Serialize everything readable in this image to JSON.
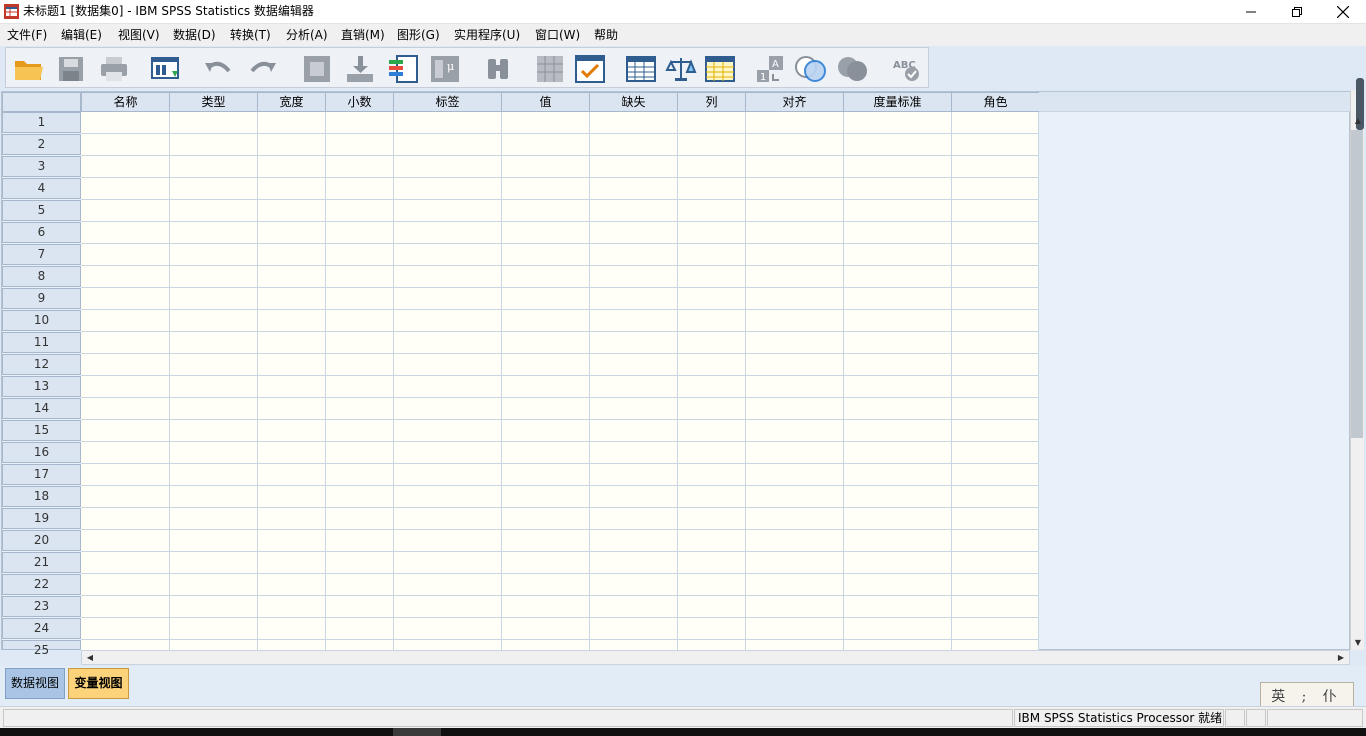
{
  "window": {
    "title": "未标题1 [数据集0] - IBM SPSS Statistics 数据编辑器"
  },
  "menu": [
    "文件(F)",
    "编辑(E)",
    "视图(V)",
    "数据(D)",
    "转换(T)",
    "分析(A)",
    "直销(M)",
    "图形(G)",
    "实用程序(U)",
    "窗口(W)",
    "帮助"
  ],
  "toolbar": [
    {
      "icon": "open-folder-icon"
    },
    {
      "icon": "save-icon"
    },
    {
      "icon": "print-icon"
    },
    {
      "icon": "recall-dialog-icon"
    },
    {
      "icon": "undo-icon"
    },
    {
      "icon": "redo-icon"
    },
    {
      "icon": "goto-case-icon"
    },
    {
      "icon": "goto-variable-icon"
    },
    {
      "icon": "variables-icon"
    },
    {
      "icon": "run-descriptives-icon"
    },
    {
      "icon": "find-icon"
    },
    {
      "icon": "insert-cases-icon"
    },
    {
      "icon": "insert-variable-icon"
    },
    {
      "icon": "split-file-icon"
    },
    {
      "icon": "weight-cases-icon"
    },
    {
      "icon": "select-cases-icon"
    },
    {
      "icon": "value-labels-icon"
    },
    {
      "icon": "use-sets-icon"
    },
    {
      "icon": "show-all-variables-icon"
    },
    {
      "icon": "spell-check-icon"
    }
  ],
  "grid": {
    "columns": [
      "名称",
      "类型",
      "宽度",
      "小数",
      "标签",
      "值",
      "缺失",
      "列",
      "对齐",
      "度量标准",
      "角色"
    ],
    "rows": [
      "1",
      "2",
      "3",
      "4",
      "5",
      "6",
      "7",
      "8",
      "9",
      "10",
      "11",
      "12",
      "13",
      "14",
      "15",
      "16",
      "17",
      "18",
      "19",
      "20",
      "21",
      "22",
      "23",
      "24",
      "25"
    ]
  },
  "tabs": {
    "data_view": "数据视图",
    "variable_view": "变量视图",
    "active": "variable_view"
  },
  "status": {
    "processor": "IBM SPSS Statistics Processor 就绪"
  },
  "ime": {
    "label": "英 ; 仆"
  },
  "colors": {
    "header": "#dbe5f1",
    "active_tab": "#fcd37a",
    "inactive_tab": "#a9c4e4",
    "cell_bg": "#fffff8"
  }
}
